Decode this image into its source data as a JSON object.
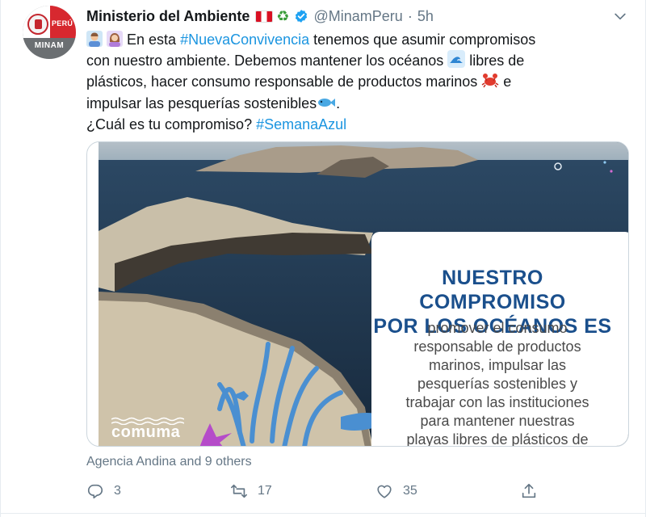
{
  "account": {
    "name": "Ministerio del Ambiente",
    "handle": "@MinamPeru",
    "separator": "·",
    "time": "5h",
    "avatar": {
      "peru": "PERÚ",
      "minam": "MINAM"
    }
  },
  "tweet": {
    "line1_pre": "En esta ",
    "line1_hashtag": "#NuevaConvivencia",
    "line1_post": " tenemos que asumir compromisos",
    "line2_pre": "con nuestro ambiente. Debemos mantener los océanos ",
    "line2_post": " libres de",
    "line3_pre": "plásticos, hacer consumo responsable de productos marinos ",
    "line3_post": " e",
    "line4_pre": "impulsar las pesquerías sostenibles",
    "line4_post": ".",
    "line5_pre": "¿Cuál es tu compromiso? ",
    "line5_hashtag": "#SemanaAzul"
  },
  "media": {
    "card_title_line1": "NUESTRO COMPROMISO",
    "card_title_line2": "POR LOS OCÉANOS ES",
    "card_body": [
      "promover el consumo",
      "responsable de productos",
      "marinos, impulsar las",
      "pesquerías sostenibles y",
      "trabajar con las instituciones",
      "para mantener nuestras",
      "playas libres de plásticos de"
    ],
    "watermark": "comuma"
  },
  "liked_by": "Agencia Andina and 9 others",
  "actions": {
    "replies": "3",
    "retweets": "17",
    "likes": "35"
  },
  "colors": {
    "link": "#1b95e0",
    "muted": "#657786",
    "title_blue": "#1a4f8c"
  },
  "icons": [
    "chevron-down-icon",
    "reply-icon",
    "retweet-icon",
    "like-icon",
    "share-icon",
    "verified-badge-icon"
  ]
}
